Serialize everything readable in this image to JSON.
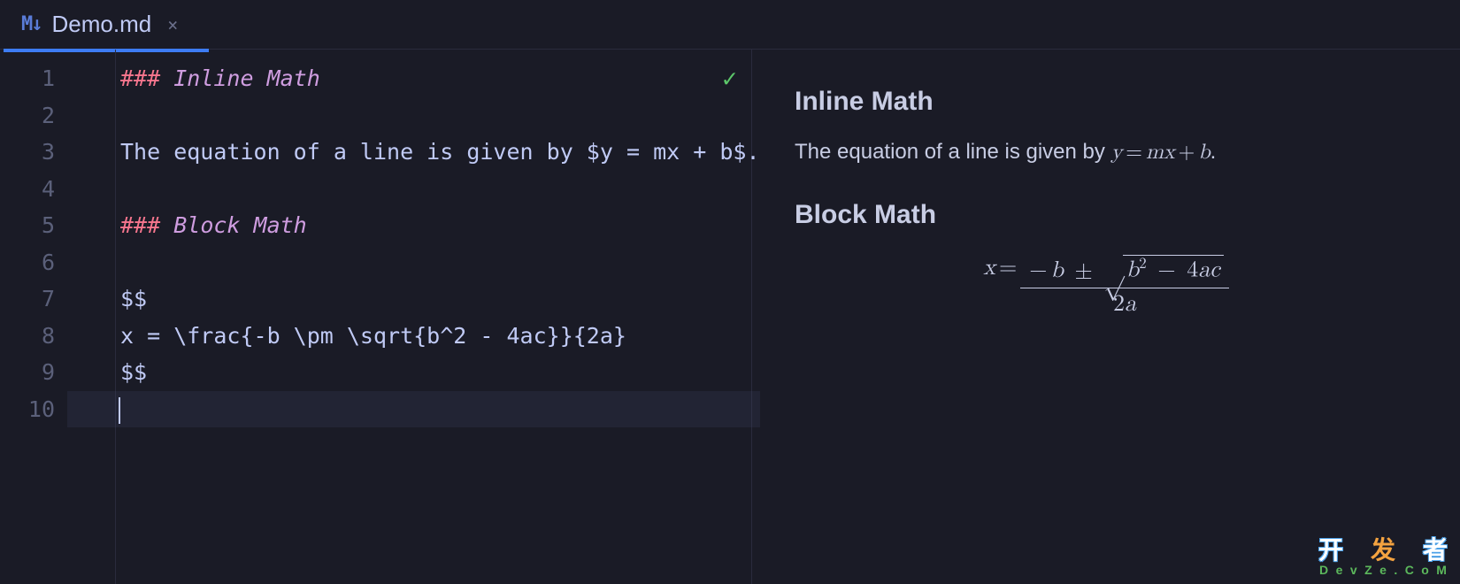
{
  "tab": {
    "icon_text": "M↓",
    "title": "Demo.md",
    "close": "×"
  },
  "status": {
    "check": "✓"
  },
  "editor": {
    "lines": [
      {
        "n": "1",
        "segments": [
          {
            "cls": "tok-hash",
            "t": "### "
          },
          {
            "cls": "tok-head",
            "t": "Inline Math"
          }
        ]
      },
      {
        "n": "2",
        "segments": []
      },
      {
        "n": "3",
        "segments": [
          {
            "cls": "",
            "t": "The equation of a line is given by "
          },
          {
            "cls": "tok-delim",
            "t": "$"
          },
          {
            "cls": "tok-math",
            "t": "y = mx + b"
          },
          {
            "cls": "tok-delim",
            "t": "$"
          },
          {
            "cls": "",
            "t": "."
          }
        ]
      },
      {
        "n": "4",
        "segments": []
      },
      {
        "n": "5",
        "segments": [
          {
            "cls": "tok-hash",
            "t": "### "
          },
          {
            "cls": "tok-head",
            "t": "Block Math"
          }
        ]
      },
      {
        "n": "6",
        "segments": []
      },
      {
        "n": "7",
        "segments": [
          {
            "cls": "tok-delim",
            "t": "$$"
          }
        ]
      },
      {
        "n": "8",
        "segments": [
          {
            "cls": "tok-math",
            "t": "x = \\frac{-b \\pm \\sqrt{b^2 - 4ac}}{2a}"
          }
        ]
      },
      {
        "n": "9",
        "segments": [
          {
            "cls": "tok-delim",
            "t": "$$"
          }
        ]
      },
      {
        "n": "10",
        "segments": [],
        "current": true,
        "cursor": true
      }
    ]
  },
  "preview": {
    "h1": "Inline Math",
    "p1_prefix": "The equation of a line is given by ",
    "p1_math": {
      "y": "y",
      "eq": "=",
      "m": "m",
      "x": "x",
      "plus": "+",
      "b": "b"
    },
    "p1_suffix": ".",
    "h2": "Block Math",
    "block": {
      "lhs_x": "x",
      "eq": "=",
      "num_minus": "−",
      "num_b": "b",
      "pm": "±",
      "sqrt_b": "b",
      "sqrt_sup": "2",
      "sqrt_minus": "−",
      "sqrt_4": "4",
      "sqrt_a": "a",
      "sqrt_c": "c",
      "den_2": "2",
      "den_a": "a"
    }
  },
  "watermark": {
    "top": [
      "开",
      "发",
      "者"
    ],
    "bottom": [
      "D",
      "e",
      "v",
      "Z",
      "e",
      ".",
      "C",
      "o",
      "M"
    ]
  }
}
